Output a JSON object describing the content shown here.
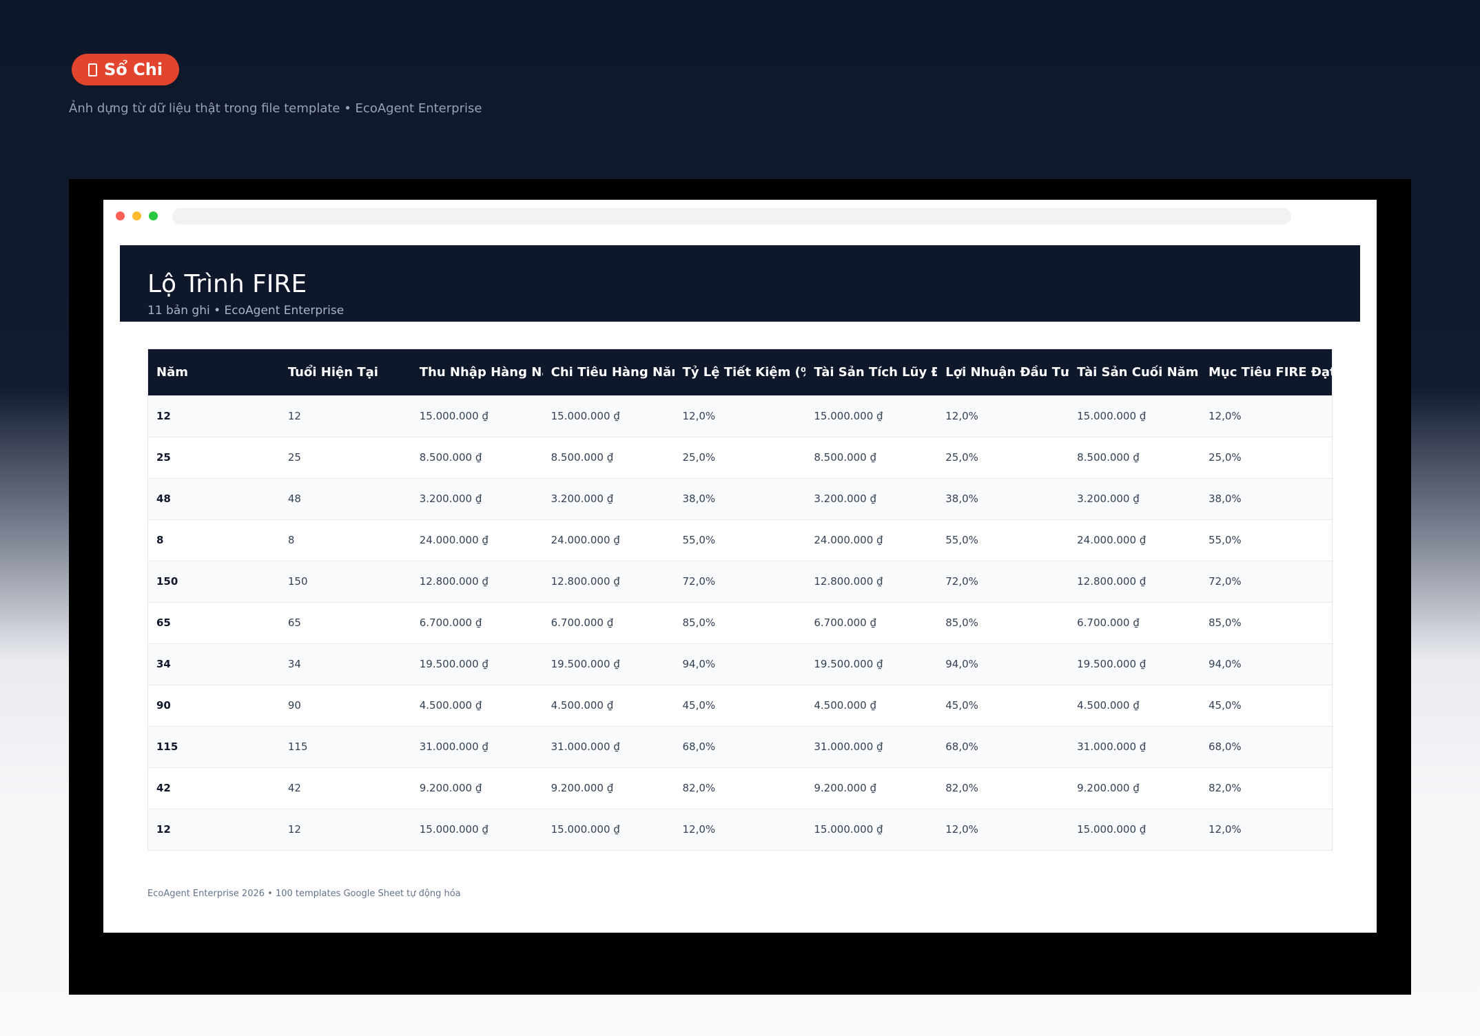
{
  "badge": {
    "icon": "document-icon",
    "label": "Sổ Chi",
    "color": "#e2452d"
  },
  "subtitle": "Ảnh dựng từ dữ liệu thật trong file template • EcoAgent Enterprise",
  "header": {
    "title": "Lộ Trình FIRE",
    "subtitle": "11 bản ghi • EcoAgent Enterprise"
  },
  "table": {
    "columns": [
      "Năm",
      "Tuổi Hiện Tại",
      "Thu Nhập Hàng Năm",
      "Chi Tiêu Hàng Năm",
      "Tỷ Lệ Tiết Kiệm (%",
      "Tài Sản Tích Lũy Đ",
      "Lợi Nhuận Đầu Tư (",
      "Tài Sản Cuối Năm",
      "Mục Tiêu FIRE Đạt"
    ],
    "rows": [
      [
        "12",
        "12",
        "15.000.000 ₫",
        "15.000.000 ₫",
        "12,0%",
        "15.000.000 ₫",
        "12,0%",
        "15.000.000 ₫",
        "12,0%"
      ],
      [
        "25",
        "25",
        "8.500.000 ₫",
        "8.500.000 ₫",
        "25,0%",
        "8.500.000 ₫",
        "25,0%",
        "8.500.000 ₫",
        "25,0%"
      ],
      [
        "48",
        "48",
        "3.200.000 ₫",
        "3.200.000 ₫",
        "38,0%",
        "3.200.000 ₫",
        "38,0%",
        "3.200.000 ₫",
        "38,0%"
      ],
      [
        "8",
        "8",
        "24.000.000 ₫",
        "24.000.000 ₫",
        "55,0%",
        "24.000.000 ₫",
        "55,0%",
        "24.000.000 ₫",
        "55,0%"
      ],
      [
        "150",
        "150",
        "12.800.000 ₫",
        "12.800.000 ₫",
        "72,0%",
        "12.800.000 ₫",
        "72,0%",
        "12.800.000 ₫",
        "72,0%"
      ],
      [
        "65",
        "65",
        "6.700.000 ₫",
        "6.700.000 ₫",
        "85,0%",
        "6.700.000 ₫",
        "85,0%",
        "6.700.000 ₫",
        "85,0%"
      ],
      [
        "34",
        "34",
        "19.500.000 ₫",
        "19.500.000 ₫",
        "94,0%",
        "19.500.000 ₫",
        "94,0%",
        "19.500.000 ₫",
        "94,0%"
      ],
      [
        "90",
        "90",
        "4.500.000 ₫",
        "4.500.000 ₫",
        "45,0%",
        "4.500.000 ₫",
        "45,0%",
        "4.500.000 ₫",
        "45,0%"
      ],
      [
        "115",
        "115",
        "31.000.000 ₫",
        "31.000.000 ₫",
        "68,0%",
        "31.000.000 ₫",
        "68,0%",
        "31.000.000 ₫",
        "68,0%"
      ],
      [
        "42",
        "42",
        "9.200.000 ₫",
        "9.200.000 ₫",
        "82,0%",
        "9.200.000 ₫",
        "82,0%",
        "9.200.000 ₫",
        "82,0%"
      ],
      [
        "12",
        "12",
        "15.000.000 ₫",
        "15.000.000 ₫",
        "12,0%",
        "15.000.000 ₫",
        "12,0%",
        "15.000.000 ₫",
        "12,0%"
      ]
    ]
  },
  "footer": "EcoAgent Enterprise 2026 • 100 templates Google Sheet tự động hóa",
  "colors": {
    "header_bg": "#0f172a",
    "accent": "#e2452d",
    "row_alt": "#f8fafc"
  }
}
